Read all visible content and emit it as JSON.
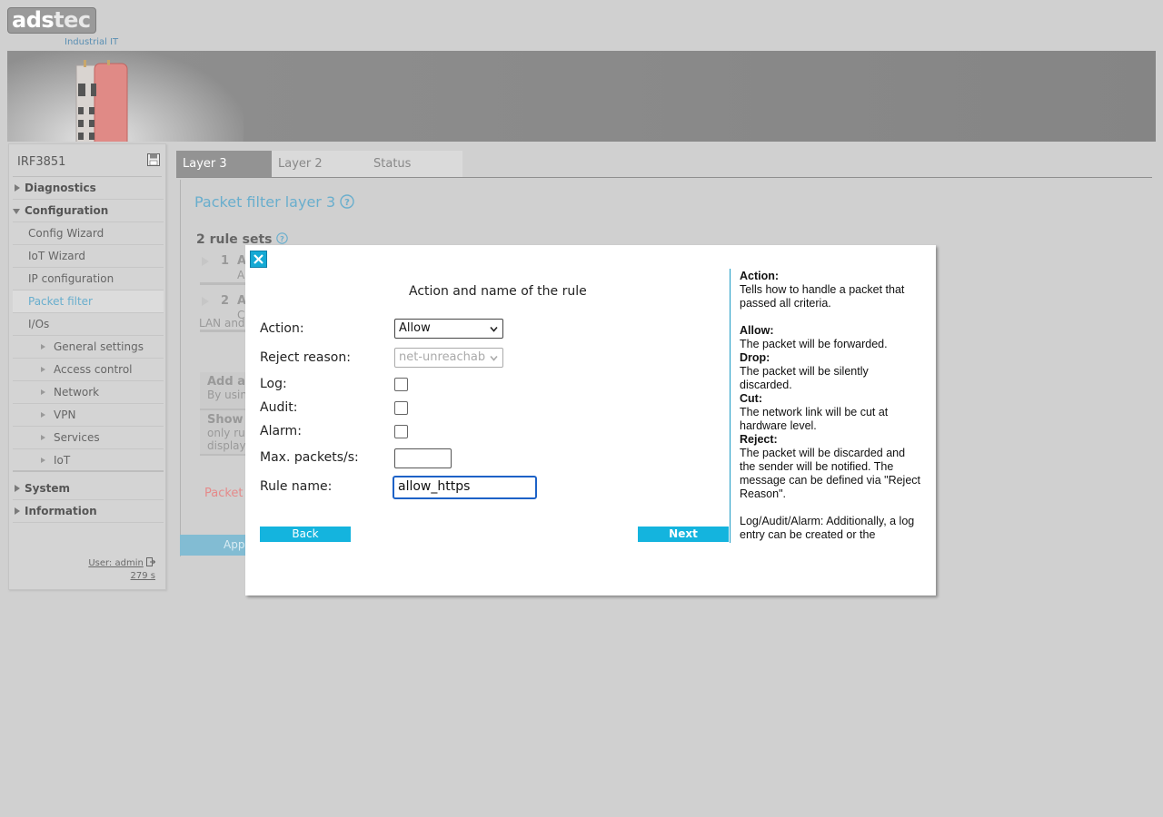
{
  "brand": {
    "logo_text_a": "ads",
    "logo_text_b": "tec",
    "logo_sub": "Industrial IT"
  },
  "sidebar": {
    "device_name": "IRF3851",
    "items": [
      {
        "label": "Diagnostics"
      },
      {
        "label": "Configuration"
      },
      {
        "label": "Config Wizard"
      },
      {
        "label": "IoT Wizard"
      },
      {
        "label": "IP configuration"
      },
      {
        "label": "Packet filter"
      },
      {
        "label": "I/Os"
      },
      {
        "label": "General settings"
      },
      {
        "label": "Access control"
      },
      {
        "label": "Network"
      },
      {
        "label": "VPN"
      },
      {
        "label": "Services"
      },
      {
        "label": "IoT"
      },
      {
        "label": "System"
      },
      {
        "label": "Information"
      }
    ],
    "user_label": "User: admin",
    "timer": "279 s"
  },
  "tabs": [
    {
      "label": "Layer 3"
    },
    {
      "label": "Layer 2"
    },
    {
      "label": "Status"
    }
  ],
  "main": {
    "title": "Packet filter layer 3",
    "rule_sets": "2 rule sets",
    "row1_num": "1",
    "row1_a": "A",
    "row1_sub": "A",
    "row2_num": "2",
    "row2_a": "A",
    "row2_sub": "C",
    "row2_lan": "LAN and",
    "add_title": "Add a",
    "add_sub": "By usin",
    "show_title": "Show",
    "show_sub1": "only ru",
    "show_sub2": "display",
    "packet_red": "Packet",
    "apply": "Appl"
  },
  "modal": {
    "heading": "Action and name of the rule",
    "action_label": "Action:",
    "action_value": "Allow",
    "reject_label": "Reject reason:",
    "reject_value": "net-unreachab",
    "log_label": "Log:",
    "audit_label": "Audit:",
    "alarm_label": "Alarm:",
    "maxpps_label": "Max. packets/s:",
    "maxpps_value": "",
    "rulename_label": "Rule name:",
    "rulename_value": "allow_https",
    "back_label": "Back",
    "next_label": "Next"
  },
  "help": {
    "action_title": "Action:",
    "action_text": "Tells how to handle a packet that passed all criteria.",
    "allow_title": "Allow:",
    "allow_text": "The packet will be forwarded.",
    "drop_title": "Drop:",
    "drop_text": "The packet will be silently discarded.",
    "cut_title": "Cut:",
    "cut_text": "The network link will be cut at hardware level.",
    "reject_title": "Reject:",
    "reject_text": "The packet will be discarded and the sender will be notified. The message can be defined via \"Reject Reason\".",
    "log_text": "Log/Audit/Alarm: Additionally, a log entry can be created or the"
  },
  "colors": {
    "accent": "#14b4de",
    "link_blue": "#69aecd",
    "focus_blue": "#1d62c7"
  }
}
